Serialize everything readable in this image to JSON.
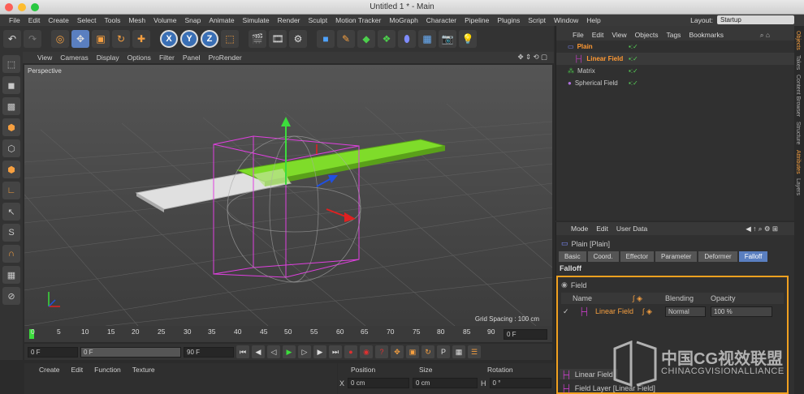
{
  "window": {
    "title": "Untitled 1 * - Main"
  },
  "menubar": {
    "items": [
      "File",
      "Edit",
      "Create",
      "Select",
      "Tools",
      "Mesh",
      "Volume",
      "Snap",
      "Animate",
      "Simulate",
      "Render",
      "Sculpt",
      "Motion Tracker",
      "MoGraph",
      "Character",
      "Pipeline",
      "Plugins",
      "Script",
      "Window",
      "Help"
    ],
    "layout_label": "Layout:",
    "layout_value": "Startup"
  },
  "toolbar": {
    "axis_x": "X",
    "axis_y": "Y",
    "axis_z": "Z"
  },
  "viewport_menu": {
    "items": [
      "View",
      "Cameras",
      "Display",
      "Options",
      "Filter",
      "Panel",
      "ProRender"
    ]
  },
  "viewport": {
    "label": "Perspective",
    "grid_spacing": "Grid Spacing : 100 cm"
  },
  "timeline": {
    "ticks": [
      "0",
      "5",
      "10",
      "15",
      "20",
      "25",
      "30",
      "35",
      "40",
      "45",
      "50",
      "55",
      "60",
      "65",
      "70",
      "75",
      "80",
      "85",
      "90"
    ],
    "current_frame": "0 F"
  },
  "timeline_controls": {
    "start_field": "0 F",
    "min_field": "0 F",
    "max_field": "90 F",
    "end_field": "90 F"
  },
  "bottom_menu": {
    "items": [
      "Create",
      "Edit",
      "Function",
      "Texture"
    ]
  },
  "coords": {
    "position_label": "Position",
    "size_label": "Size",
    "rotation_label": "Rotation",
    "x_label": "X",
    "x_value": "0 cm",
    "size_x_value": "0 cm",
    "h_label": "H",
    "h_value": "0 °"
  },
  "objects_panel": {
    "menu": [
      "File",
      "Edit",
      "View",
      "Objects",
      "Tags",
      "Bookmarks"
    ],
    "rows": [
      {
        "name": "Plain",
        "color": "#ff9933"
      },
      {
        "name": "Linear Field",
        "color": "#ff9933"
      },
      {
        "name": "Matrix",
        "color": "#c8c8c8"
      },
      {
        "name": "Spherical Field",
        "color": "#c8c8c8"
      }
    ]
  },
  "attributes_panel": {
    "menu": [
      "Mode",
      "Edit",
      "User Data"
    ],
    "object_title": "Plain [Plain]",
    "tabs": [
      "Basic",
      "Coord.",
      "Effector",
      "Parameter",
      "Deformer",
      "Falloff"
    ],
    "active_tab": "Falloff",
    "section_title": "Falloff",
    "field_label": "Field",
    "columns": {
      "name": "Name",
      "blending": "Blending",
      "opacity": "Opacity"
    },
    "field_row": {
      "name": "Linear Field",
      "blending": "Normal",
      "opacity": "100 %"
    },
    "field_layer_button": "Linear Field",
    "field_layer_title": "Field Layer [Linear Field]"
  },
  "side_strip": {
    "labels": [
      "Objects",
      "Takes",
      "Content Browser",
      "Structure",
      "Attributes",
      "Layers"
    ]
  },
  "watermark": {
    "cn": "中国CG视效联盟",
    "en": "CHINACGVISIONALLIANCE"
  },
  "colors": {
    "highlight_orange": "#f0a020",
    "accent_blue": "#5a7fc0",
    "plane_green": "#7fdc2a"
  }
}
